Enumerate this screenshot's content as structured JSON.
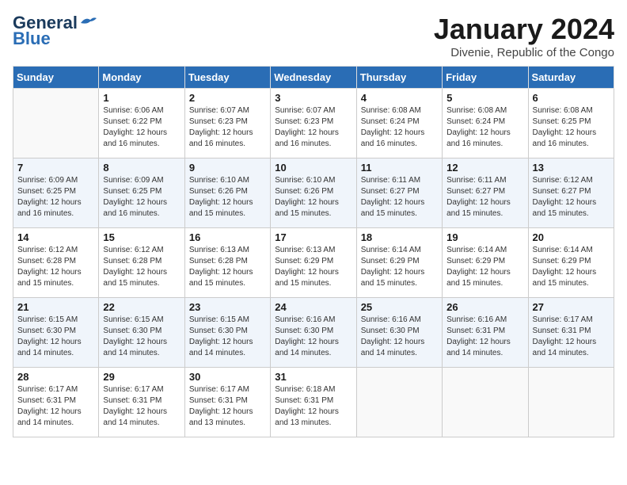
{
  "logo": {
    "general": "General",
    "blue": "Blue"
  },
  "title": "January 2024",
  "location": "Divenie, Republic of the Congo",
  "days_of_week": [
    "Sunday",
    "Monday",
    "Tuesday",
    "Wednesday",
    "Thursday",
    "Friday",
    "Saturday"
  ],
  "weeks": [
    [
      {
        "day": "",
        "info": ""
      },
      {
        "day": "1",
        "info": "Sunrise: 6:06 AM\nSunset: 6:22 PM\nDaylight: 12 hours and 16 minutes."
      },
      {
        "day": "2",
        "info": "Sunrise: 6:07 AM\nSunset: 6:23 PM\nDaylight: 12 hours and 16 minutes."
      },
      {
        "day": "3",
        "info": "Sunrise: 6:07 AM\nSunset: 6:23 PM\nDaylight: 12 hours and 16 minutes."
      },
      {
        "day": "4",
        "info": "Sunrise: 6:08 AM\nSunset: 6:24 PM\nDaylight: 12 hours and 16 minutes."
      },
      {
        "day": "5",
        "info": "Sunrise: 6:08 AM\nSunset: 6:24 PM\nDaylight: 12 hours and 16 minutes."
      },
      {
        "day": "6",
        "info": "Sunrise: 6:08 AM\nSunset: 6:25 PM\nDaylight: 12 hours and 16 minutes."
      }
    ],
    [
      {
        "day": "7",
        "info": "Sunrise: 6:09 AM\nSunset: 6:25 PM\nDaylight: 12 hours and 16 minutes."
      },
      {
        "day": "8",
        "info": "Sunrise: 6:09 AM\nSunset: 6:25 PM\nDaylight: 12 hours and 16 minutes."
      },
      {
        "day": "9",
        "info": "Sunrise: 6:10 AM\nSunset: 6:26 PM\nDaylight: 12 hours and 15 minutes."
      },
      {
        "day": "10",
        "info": "Sunrise: 6:10 AM\nSunset: 6:26 PM\nDaylight: 12 hours and 15 minutes."
      },
      {
        "day": "11",
        "info": "Sunrise: 6:11 AM\nSunset: 6:27 PM\nDaylight: 12 hours and 15 minutes."
      },
      {
        "day": "12",
        "info": "Sunrise: 6:11 AM\nSunset: 6:27 PM\nDaylight: 12 hours and 15 minutes."
      },
      {
        "day": "13",
        "info": "Sunrise: 6:12 AM\nSunset: 6:27 PM\nDaylight: 12 hours and 15 minutes."
      }
    ],
    [
      {
        "day": "14",
        "info": "Sunrise: 6:12 AM\nSunset: 6:28 PM\nDaylight: 12 hours and 15 minutes."
      },
      {
        "day": "15",
        "info": "Sunrise: 6:12 AM\nSunset: 6:28 PM\nDaylight: 12 hours and 15 minutes."
      },
      {
        "day": "16",
        "info": "Sunrise: 6:13 AM\nSunset: 6:28 PM\nDaylight: 12 hours and 15 minutes."
      },
      {
        "day": "17",
        "info": "Sunrise: 6:13 AM\nSunset: 6:29 PM\nDaylight: 12 hours and 15 minutes."
      },
      {
        "day": "18",
        "info": "Sunrise: 6:14 AM\nSunset: 6:29 PM\nDaylight: 12 hours and 15 minutes."
      },
      {
        "day": "19",
        "info": "Sunrise: 6:14 AM\nSunset: 6:29 PM\nDaylight: 12 hours and 15 minutes."
      },
      {
        "day": "20",
        "info": "Sunrise: 6:14 AM\nSunset: 6:29 PM\nDaylight: 12 hours and 15 minutes."
      }
    ],
    [
      {
        "day": "21",
        "info": "Sunrise: 6:15 AM\nSunset: 6:30 PM\nDaylight: 12 hours and 14 minutes."
      },
      {
        "day": "22",
        "info": "Sunrise: 6:15 AM\nSunset: 6:30 PM\nDaylight: 12 hours and 14 minutes."
      },
      {
        "day": "23",
        "info": "Sunrise: 6:15 AM\nSunset: 6:30 PM\nDaylight: 12 hours and 14 minutes."
      },
      {
        "day": "24",
        "info": "Sunrise: 6:16 AM\nSunset: 6:30 PM\nDaylight: 12 hours and 14 minutes."
      },
      {
        "day": "25",
        "info": "Sunrise: 6:16 AM\nSunset: 6:30 PM\nDaylight: 12 hours and 14 minutes."
      },
      {
        "day": "26",
        "info": "Sunrise: 6:16 AM\nSunset: 6:31 PM\nDaylight: 12 hours and 14 minutes."
      },
      {
        "day": "27",
        "info": "Sunrise: 6:17 AM\nSunset: 6:31 PM\nDaylight: 12 hours and 14 minutes."
      }
    ],
    [
      {
        "day": "28",
        "info": "Sunrise: 6:17 AM\nSunset: 6:31 PM\nDaylight: 12 hours and 14 minutes."
      },
      {
        "day": "29",
        "info": "Sunrise: 6:17 AM\nSunset: 6:31 PM\nDaylight: 12 hours and 14 minutes."
      },
      {
        "day": "30",
        "info": "Sunrise: 6:17 AM\nSunset: 6:31 PM\nDaylight: 12 hours and 13 minutes."
      },
      {
        "day": "31",
        "info": "Sunrise: 6:18 AM\nSunset: 6:31 PM\nDaylight: 12 hours and 13 minutes."
      },
      {
        "day": "",
        "info": ""
      },
      {
        "day": "",
        "info": ""
      },
      {
        "day": "",
        "info": ""
      }
    ]
  ]
}
